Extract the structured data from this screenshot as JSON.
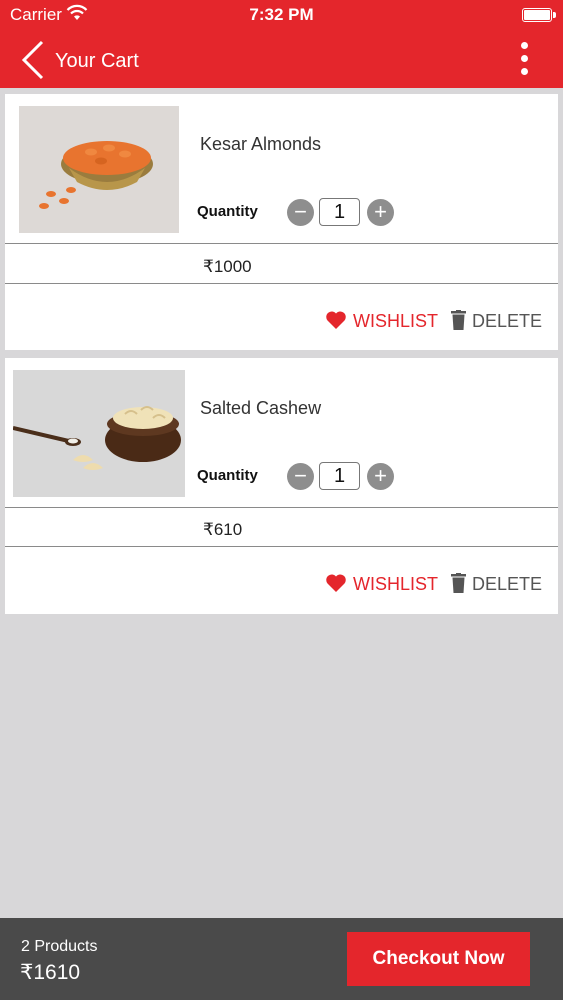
{
  "status_bar": {
    "carrier": "Carrier",
    "time": "7:32 PM"
  },
  "header": {
    "title": "Your Cart"
  },
  "cart": {
    "items": [
      {
        "name": "Kesar Almonds",
        "quantity_label": "Quantity",
        "quantity": "1",
        "price": "₹1000",
        "wishlist_label": "WISHLIST",
        "delete_label": "DELETE"
      },
      {
        "name": "Salted Cashew",
        "quantity_label": "Quantity",
        "quantity": "1",
        "price": "₹610",
        "wishlist_label": "WISHLIST",
        "delete_label": "DELETE"
      }
    ]
  },
  "footer": {
    "product_count": "2 Products",
    "total": "₹1610",
    "checkout_label": "Checkout Now"
  },
  "icons": {
    "back": "back-chevron-icon",
    "more": "more-vertical-icon",
    "wishlist": "heart-icon",
    "delete": "trash-icon",
    "minus": "minus-icon",
    "plus": "plus-icon"
  },
  "colors": {
    "brand_red": "#e4262c",
    "background": "#d8d7d9",
    "footer": "#4a4a4a"
  }
}
